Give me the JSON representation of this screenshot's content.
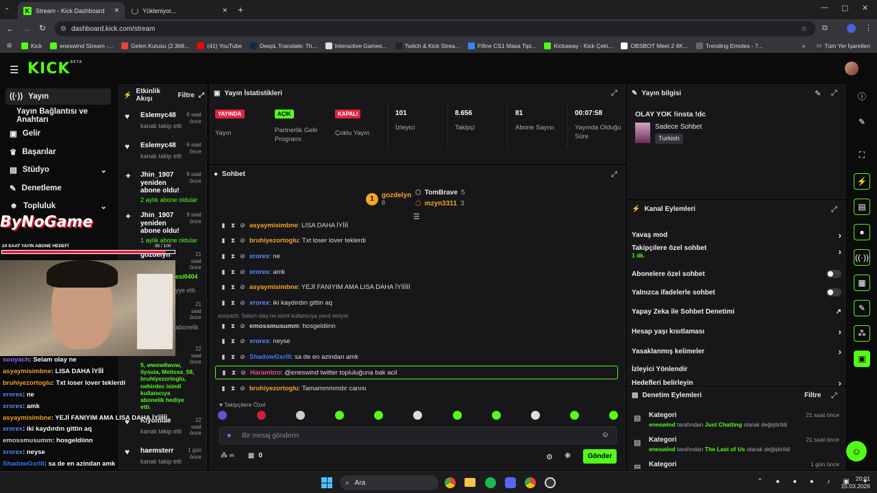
{
  "browser": {
    "tabs": [
      {
        "title": "Stream - Kick Dashboard"
      },
      {
        "title": "Yükleniyor..."
      }
    ],
    "url": "dashboard.kick.com/stream",
    "bookmarks": [
      "Kick",
      "eneswind Stream -...",
      "Gelen Kutusu (2.368...",
      "(41) YouTube",
      "DeepL Translate: Th...",
      "Interactive Games...",
      "Twitch & Kick Strea...",
      "Fifine CS1 Masa Tipi...",
      "Kickaway - Kick Çeki...",
      "OBSBOT Meet 2 4K...",
      "Trending Emotes - 7..."
    ],
    "all_bookmarks": "Tüm Yer İşaretleri"
  },
  "app": {
    "logo": "KICK",
    "beta": "BETA"
  },
  "sidebar": {
    "items": [
      {
        "label": "Yayın",
        "icon": "broadcast-icon"
      },
      {
        "label": "Yayın Bağlantısı ve Anahtarı",
        "icon": ""
      },
      {
        "label": "Gelir",
        "icon": "money-icon"
      },
      {
        "label": "Başarılar",
        "icon": "trophy-icon"
      },
      {
        "label": "Stüdyo",
        "icon": "studio-icon"
      },
      {
        "label": "Denetleme",
        "icon": "wrench-icon"
      },
      {
        "label": "Topluluk",
        "icon": "community-icon"
      }
    ]
  },
  "activity": {
    "title": "Etkinlik Akışı",
    "filter": "Filtre",
    "events": [
      {
        "name": "Eslemyc48",
        "desc": "kanalı takip etti",
        "time": "6 saat önce"
      },
      {
        "name": "Eslemyc48",
        "desc": "kanalı takip etti",
        "time": "6 saat önce"
      },
      {
        "name": "Jhin_1907 yeniden abone oldu!",
        "desc": "2 aylık abone oldular",
        "time": "9 saat önce"
      },
      {
        "name": "Jhin_1907 yeniden abone oldu!",
        "desc": "1 aylık abone oldular",
        "time": "9 saat önce"
      },
      {
        "name": "gozdelyn",
        "desc": "",
        "time": "21 saat önce"
      },
      {
        "name": "",
        "desc": "",
        "time": "21 saat önce"
      },
      {
        "name": "",
        "desc": "",
        "time": "22 saat önce"
      },
      {
        "name": "Kiyomiae",
        "desc": "kanalı takip etti",
        "time": "22 saat önce"
      },
      {
        "name": "haemsterr",
        "desc": "kanalı takip etti",
        "time": "1 gün önce"
      }
    ],
    "gift_text": "5, wwow6wow, ilysuia, Melissa_58, bruhiyezortoglu, nehirdec isimli kullanıcıya abonelik hediye etti.",
    "partial_1": "esi0404",
    "partial_2": "yye etti.",
    "partial_3": "abonelik"
  },
  "stats": {
    "title": "Yayın İstatistikleri",
    "badges": [
      {
        "badge": "YAYINDA",
        "label": "Yayın",
        "color": "#e0243d"
      },
      {
        "badge": "AÇIK",
        "label": "Partnerlik Gelir Programı",
        "color": "#53fc18"
      },
      {
        "badge": "KAPALI",
        "label": "Çoklu Yayın",
        "color": "#e0243d"
      }
    ],
    "numbers": [
      {
        "value": "101",
        "label": "İzleyici"
      },
      {
        "value": "8.656",
        "label": "Takipçi"
      },
      {
        "value": "81",
        "label": "Abone Sayısı"
      },
      {
        "value": "00:07:58",
        "label": "Yayında Olduğu Süre"
      }
    ]
  },
  "chat": {
    "title": "Sohbet",
    "leaders": [
      {
        "name": "gozdelyn",
        "count": "8"
      },
      {
        "name": "TomBrave",
        "count": "5"
      },
      {
        "name": "mzyn3311",
        "count": "3"
      }
    ],
    "messages": [
      {
        "user": "asyaymisimbne",
        "text": ": LISA DAHA İYİİİ",
        "color": "#f5a623"
      },
      {
        "user": "bruhiyezortoglu",
        "text": ": Txt loser lover teklerdi",
        "color": "#f5a623"
      },
      {
        "user": "xrorex",
        "text": ": ne",
        "color": "#5b8cff"
      },
      {
        "user": "xrorex",
        "text": ": amk",
        "color": "#5b8cff"
      },
      {
        "user": "asyaymisimbne",
        "text": ": YEJİ FANIYIM AMA LISA DAHA İYİİİİİ",
        "color": "#f5a623"
      },
      {
        "user": "xrorex",
        "text": ": iki kaydırdın gittin aq",
        "color": "#5b8cff"
      },
      {
        "user": "emossmusumm",
        "text": ": hosgeldiinn",
        "color": "#cfcfcf"
      },
      {
        "user": "xrorex",
        "text": ": neyse",
        "color": "#5b8cff"
      },
      {
        "user": "ShadowGxrlll",
        "text": ": sa de en azindan amk",
        "color": "#3a7bff"
      },
      {
        "user": "Harambro",
        "text": ": @eneswind twitter topluluğuna bak acil",
        "color": "#e84c8a"
      },
      {
        "user": "bruhiyezortoglu",
        "text": ": Tamammmmdır canısı",
        "color": "#f5a623"
      }
    ],
    "reply_hint": "sooyach: Selam olay ne isimli kullanıcıya yanıt veriyor",
    "emote_label": "Takipçilere Özel",
    "input_placeholder": "Bir mesaj gönderin",
    "points": "0",
    "send": "Gönder"
  },
  "stream_info": {
    "title": "Yayın bilgisi",
    "stream_title": "OLAY YOK !insta !dc",
    "category": "Sadece Sohbet",
    "tag": "Turkish"
  },
  "channel_actions": {
    "title": "Kanal Eylemleri",
    "items": [
      {
        "label": "Yavaş mod",
        "type": "arrow",
        "sub": ""
      },
      {
        "label": "Takipçilere özel sohbet",
        "type": "arrow",
        "sub": "1 dk."
      },
      {
        "label": "Abonelere özel sohbet",
        "type": "toggle",
        "sub": ""
      },
      {
        "label": "Yalnızca ifadelerle sohbet",
        "type": "toggle",
        "sub": ""
      },
      {
        "label": "Yapay Zeka ile Sohbet Denetimi",
        "type": "link",
        "sub": ""
      },
      {
        "label": "Hesap yaşı kısıtlaması",
        "type": "arrow",
        "sub": ""
      },
      {
        "label": "Yasaklanmış kelimeler",
        "type": "arrow",
        "sub": ""
      },
      {
        "label": "İzleyici Yönlendir",
        "type": "none",
        "sub": ""
      },
      {
        "label": "Hedefleri belirleyin",
        "type": "arrow",
        "sub": ""
      }
    ]
  },
  "mod_actions": {
    "title": "Denetim Eylemleri",
    "filter": "Filtre",
    "items": [
      {
        "title": "Kategori",
        "user": "eneswind",
        "mid": "tarafından",
        "value": "Just Chatting",
        "tail": "olarak değiştirildi",
        "time": "21 saat önce"
      },
      {
        "title": "Kategori",
        "user": "eneswind",
        "mid": "tarafından",
        "value": "The Last of Us",
        "tail": "olarak değiştirildi",
        "time": "21 saat önce"
      },
      {
        "title": "Kategori",
        "user": "",
        "mid": "",
        "value": "",
        "tail": "",
        "time": "1 gün önce"
      }
    ]
  },
  "overlay": {
    "logo_text": "ByNoGame",
    "goal_label": "24 SAAT YAYIN ABONE HEDEFİ",
    "goal_value": "95 / 100",
    "goal_fraction": 0.95,
    "chat_lines": [
      {
        "user": "sooyach",
        "text": ": Selam olay ne",
        "color": "#9b6bff"
      },
      {
        "user": "asyaymisimbne",
        "text": ": LISA DAHA İYİİİ",
        "color": "#f5a623"
      },
      {
        "user": "bruhiyezortoglu",
        "text": ": Txt loser lover teklerdi",
        "color": "#f5a623"
      },
      {
        "user": "xrorex",
        "text": ": ne",
        "color": "#5b8cff"
      },
      {
        "user": "xrorex",
        "text": ": amk",
        "color": "#5b8cff"
      },
      {
        "user": "asyaymisimbne",
        "text": ": YEJİ FANIYIM AMA LISA DAHA İYİİİİİ",
        "color": "#f5a623"
      },
      {
        "user": "xrorex",
        "text": ": iki kaydırdın gittin aq",
        "color": "#5b8cff"
      },
      {
        "user": "emossmusumm",
        "text": ": hosgeldiinn",
        "color": "#cfcfcf"
      },
      {
        "user": "xrorex",
        "text": ": neyse",
        "color": "#5b8cff"
      },
      {
        "user": "ShadowGxrlll",
        "text": ": sa de en azindan amk",
        "color": "#3a7bff"
      },
      {
        "user": "Harambro",
        "text": ": @eneswind twitter topluluğuna bak acil",
        "color": "#e84c8a"
      },
      {
        "user": "bruhiyezortoglu",
        "text": ": Tamammmmdır canısı",
        "color": "#f5a623"
      }
    ]
  },
  "taskbar": {
    "search": "Ara",
    "time": "20:01",
    "date": "15.03.2026"
  },
  "colors": {
    "accent": "#53fc18",
    "live": "#e0243d",
    "panel": "#17171a"
  }
}
